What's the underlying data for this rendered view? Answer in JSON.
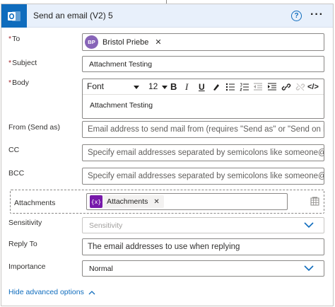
{
  "header": {
    "title": "Send an email (V2) 5"
  },
  "fields": {
    "to": {
      "label": "To",
      "required": "*",
      "recipient": {
        "initials": "BP",
        "name": "Bristol Priebe"
      }
    },
    "subject": {
      "label": "Subject",
      "required": "*",
      "value": "Attachment Testing"
    },
    "body": {
      "label": "Body",
      "required": "*",
      "font": "Font",
      "size": "12",
      "toolbar": {
        "bold": "B",
        "italic": "I",
        "underline": "U",
        "code": "</>"
      },
      "content": "Attachment Testing"
    },
    "from": {
      "label": "From (Send as)",
      "placeholder": "Email address to send mail from (requires \"Send as\" or \"Send on beh"
    },
    "cc": {
      "label": "CC",
      "placeholder": "Specify email addresses separated by semicolons like someone@con"
    },
    "bcc": {
      "label": "BCC",
      "placeholder": "Specify email addresses separated by semicolons like someone@con"
    },
    "attachments": {
      "label": "Attachments",
      "token": "Attachments",
      "token_icon": "{x}"
    },
    "sensitivity": {
      "label": "Sensitivity",
      "placeholder": "Sensitivity"
    },
    "reply_to": {
      "label": "Reply To",
      "placeholder": "The email addresses to use when replying"
    },
    "importance": {
      "label": "Importance",
      "value": "Normal"
    }
  },
  "footer": {
    "hide_advanced": "Hide advanced options"
  },
  "colors": {
    "accent": "#0f6cbd",
    "header_bg": "#e8f0fb",
    "required": "#a4262c",
    "avatar": "#8764b8",
    "token_icon": "#7719aa"
  },
  "icons": [
    "outlook-icon",
    "help-icon",
    "more-options-icon",
    "remove-icon",
    "chevron-down-icon",
    "chevron-up-icon",
    "table-icon"
  ]
}
